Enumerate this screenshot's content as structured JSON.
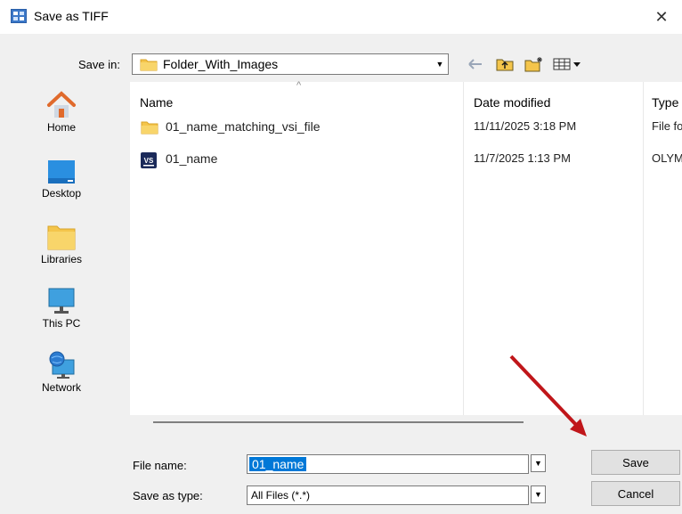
{
  "window": {
    "title": "Save as TIFF",
    "close_glyph": "✕"
  },
  "toolbar": {
    "save_in_label": "Save in:",
    "save_in_value": "Folder_With_Images",
    "icons": [
      "back-arrow-icon",
      "up-folder-icon",
      "new-folder-icon",
      "view-menu-icon"
    ]
  },
  "places": [
    {
      "label": "Home",
      "icon": "home-icon"
    },
    {
      "label": "Desktop",
      "icon": "desktop-icon"
    },
    {
      "label": "Libraries",
      "icon": "libraries-icon"
    },
    {
      "label": "This PC",
      "icon": "computer-icon"
    },
    {
      "label": "Network",
      "icon": "network-icon"
    }
  ],
  "columns": {
    "name": "Name",
    "date": "Date modified",
    "type": "Type"
  },
  "files": [
    {
      "name": "01_name_matching_vsi_file",
      "date": "11/11/2025 3:18 PM",
      "type": "File folder",
      "icon": "folder-icon"
    },
    {
      "name": "01_name",
      "date": "11/7/2025 1:13 PM",
      "type": "OLYMPUS",
      "icon": "vsi-file-icon",
      "badge": "VS"
    }
  ],
  "form": {
    "file_name_label": "File name:",
    "file_name_value": "01_name",
    "type_label": "Save as type:",
    "type_value": "All Files (*.*)",
    "save_button": "Save",
    "cancel_button": "Cancel"
  },
  "colors": {
    "accent": "#0078d7",
    "annotation_arrow": "#c0161a",
    "folder": "#f4c54b"
  }
}
